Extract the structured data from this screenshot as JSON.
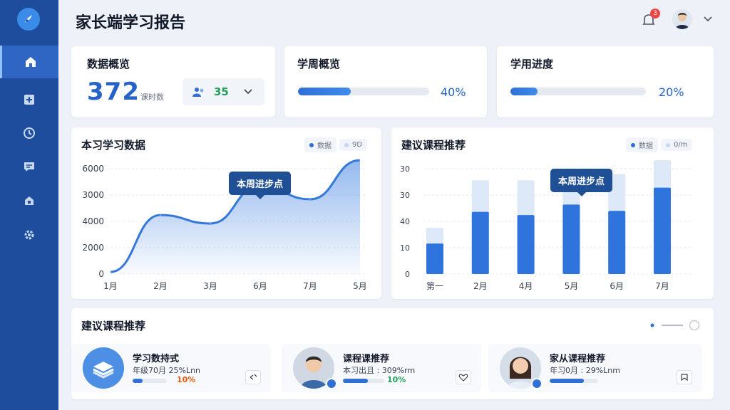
{
  "header": {
    "title": "家长端学习报告",
    "notification_count": "3"
  },
  "sidebar": {
    "items": [
      {
        "icon": "home-icon"
      },
      {
        "icon": "report-icon"
      },
      {
        "icon": "clock-icon"
      },
      {
        "icon": "message-icon"
      },
      {
        "icon": "lock-icon"
      },
      {
        "icon": "gear-icon"
      }
    ]
  },
  "overview": {
    "title": "数据概览",
    "value": "372",
    "unit": "课时数",
    "users_count": "35"
  },
  "week_overview": {
    "title": "学周概览",
    "progress": 0.4,
    "pct_label": "40%"
  },
  "study_progress": {
    "title": "学用进度",
    "progress": 0.2,
    "pct_label": "20%"
  },
  "line_section": {
    "title": "本习学习数据",
    "legend": [
      "数据",
      "9D"
    ],
    "tooltip": "本周进步点"
  },
  "bar_section": {
    "title": "建议课程推荐",
    "legend": [
      "数据",
      "0/m"
    ],
    "tooltip": "本周进步点"
  },
  "chart_data": [
    {
      "type": "line",
      "x": [
        "1月",
        "2月",
        "3月",
        "6月",
        "7月",
        "5月"
      ],
      "y_ticks": [
        "6000",
        "3000",
        "4000",
        "2000",
        "0"
      ],
      "values_frac": [
        0.02,
        0.56,
        0.48,
        0.84,
        0.71,
        1.08
      ],
      "highlight_index": 3
    },
    {
      "type": "bar",
      "categories": [
        "第一",
        "2月",
        "4月",
        "5月",
        "6月",
        "7月"
      ],
      "y_ticks": [
        "30",
        "30",
        "40",
        "10",
        "0"
      ],
      "series": [
        {
          "values": [
            0.44,
            0.89,
            0.89,
            0.86,
            0.95,
            1.08
          ]
        },
        {
          "values": [
            0.29,
            0.59,
            0.56,
            0.66,
            0.6,
            0.82
          ]
        }
      ],
      "highlight_index": 3
    }
  ],
  "recommend": {
    "title": "建议课程推荐",
    "items": [
      {
        "title": "学习数持式",
        "meta": "年级70月 25%Lnn",
        "progress": 0.3,
        "pct": "10%",
        "pct_color": "#e8590c",
        "avatar": "book-icon"
      },
      {
        "title": "课程课推荐",
        "meta": "本习出且 : 309%rm",
        "progress": 0.6,
        "pct": "10%",
        "pct_color": "#22a05a",
        "avatar": "boy-avatar"
      },
      {
        "title": "家从课程推荐",
        "meta": "年习0月 : 29%Lnm",
        "progress": 0.7,
        "pct": "",
        "pct_color": "#2563c9",
        "avatar": "girl-avatar"
      }
    ]
  },
  "colors": {
    "primary": "#2f6fd6",
    "sidebar": "#1e4d9e",
    "light_bar": "#dde8f8"
  }
}
